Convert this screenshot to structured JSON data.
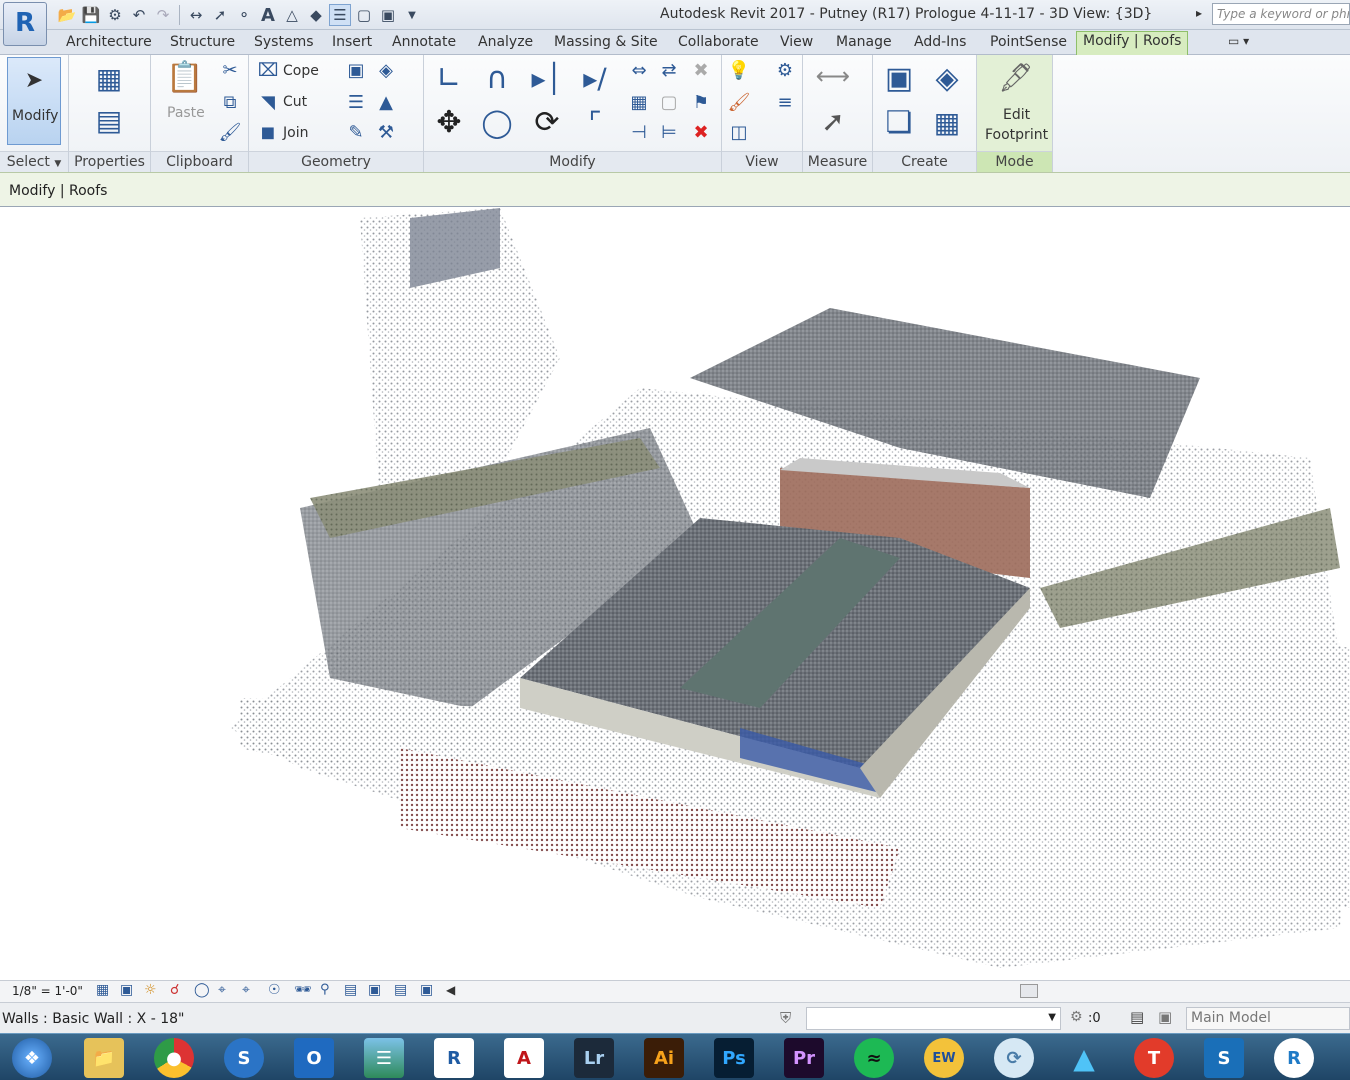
{
  "app_button_letter": "R",
  "window": {
    "title": "Autodesk Revit 2017 -     Putney (R17) Prologue 4-11-17 - 3D View: {3D}",
    "search_placeholder": "Type a keyword or phrase"
  },
  "tabs": [
    {
      "label": "Architecture"
    },
    {
      "label": "Structure"
    },
    {
      "label": "Systems"
    },
    {
      "label": "Insert"
    },
    {
      "label": "Annotate"
    },
    {
      "label": "Analyze"
    },
    {
      "label": "Massing & Site"
    },
    {
      "label": "Collaborate"
    },
    {
      "label": "View"
    },
    {
      "label": "Manage"
    },
    {
      "label": "Add-Ins"
    },
    {
      "label": "PointSense"
    },
    {
      "label": "Modify | Roofs"
    }
  ],
  "ribbon": {
    "modify_label": "Modify",
    "paste_label": "Paste",
    "cope_label": "Cope",
    "cut_label": "Cut",
    "join_label": "Join",
    "edit_footprint_line1": "Edit",
    "edit_footprint_line2": "Footprint",
    "panels": {
      "select": "Select",
      "properties": "Properties",
      "clipboard": "Clipboard",
      "geometry": "Geometry",
      "modify": "Modify",
      "view": "View",
      "measure": "Measure",
      "create": "Create",
      "mode": "Mode"
    }
  },
  "options_bar": {
    "context": "Modify | Roofs"
  },
  "view_control": {
    "scale": "1/8\" = 1'-0\""
  },
  "status": {
    "text": "Walls : Basic Wall : X - 18\"",
    "worksets": ":0",
    "model": "Main Model"
  },
  "taskbar": {
    "apps": [
      "windows-start",
      "file-explorer",
      "chrome",
      "skype-for-business",
      "outlook",
      "image-viewer",
      "revit",
      "autocad",
      "lightroom",
      "illustrator",
      "photoshop",
      "premiere",
      "spotify",
      "earthwind",
      "recap",
      "azure",
      "t-app",
      "sway",
      "revit-alt"
    ],
    "labels": {
      "skype": "S",
      "outlook": "O",
      "revit": "R",
      "autocad": "A",
      "lightroom": "Lr",
      "illustrator": "Ai",
      "photoshop": "Ps",
      "premiere": "Pr",
      "ew": "EW",
      "t": "T",
      "sway": "S",
      "revit2": "R"
    }
  },
  "colors": {
    "ribbon_context": "#d7ecc0",
    "accent_blue": "#1f63b4",
    "taskbar": "#2b567a"
  }
}
